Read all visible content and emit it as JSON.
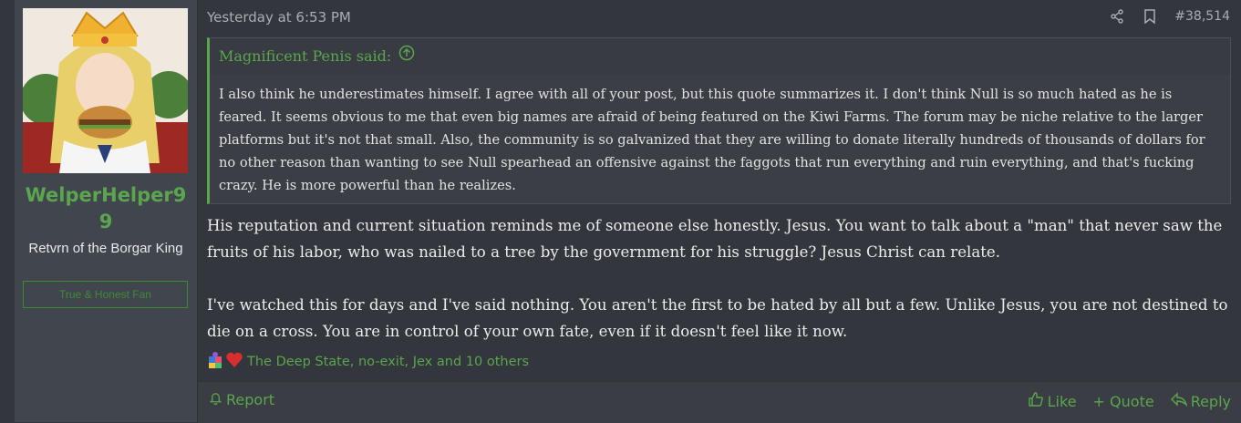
{
  "user": {
    "name": "WelperHelper99",
    "title": "Retvrn of the Borgar King",
    "banner": "True & Honest Fan"
  },
  "post": {
    "timestamp": "Yesterday at 6:53 PM",
    "number": "#38,514"
  },
  "quote": {
    "author_line": "Magnificent Penis said:",
    "body": "I also think he underestimates himself. I agree with all of your post, but this quote summarizes it. I don't think Null is so much hated as he is feared. It seems obvious to me that even big names are afraid of being featured on the Kiwi Farms. The forum may be niche relative to the larger platforms but it's not that small. Also, the community is so galvanized that they are willing to donate literally hundreds of thousands of dollars for no other reason than wanting to see Null spearhead an offensive against the faggots that run everything and ruin everything, and that's fucking crazy. He is more powerful than he realizes."
  },
  "message": {
    "paragraphs": [
      "His reputation and current situation reminds me of someone else honestly. Jesus. You want to talk about a \"man\" that never saw the fruits of his labor, who was nailed to a tree by the government for his struggle? Jesus Christ can relate.",
      "I've watched this for days and I've said nothing. You aren't the first to be hated by all but a few. Unlike Jesus, you are not destined to die on a cross. You are in control of your own fate, even if it doesn't feel like it now."
    ]
  },
  "reactions": {
    "text": "The Deep State, no-exit, Jex and 10 others",
    "icons": [
      "puzzle-icon",
      "heart-icon"
    ]
  },
  "footer": {
    "report": "Report",
    "like": "Like",
    "quote": "+ Quote",
    "reply": "Reply"
  },
  "colors": {
    "accent": "#5aa54e",
    "background": "#33363c",
    "sidebar": "#41454d"
  }
}
